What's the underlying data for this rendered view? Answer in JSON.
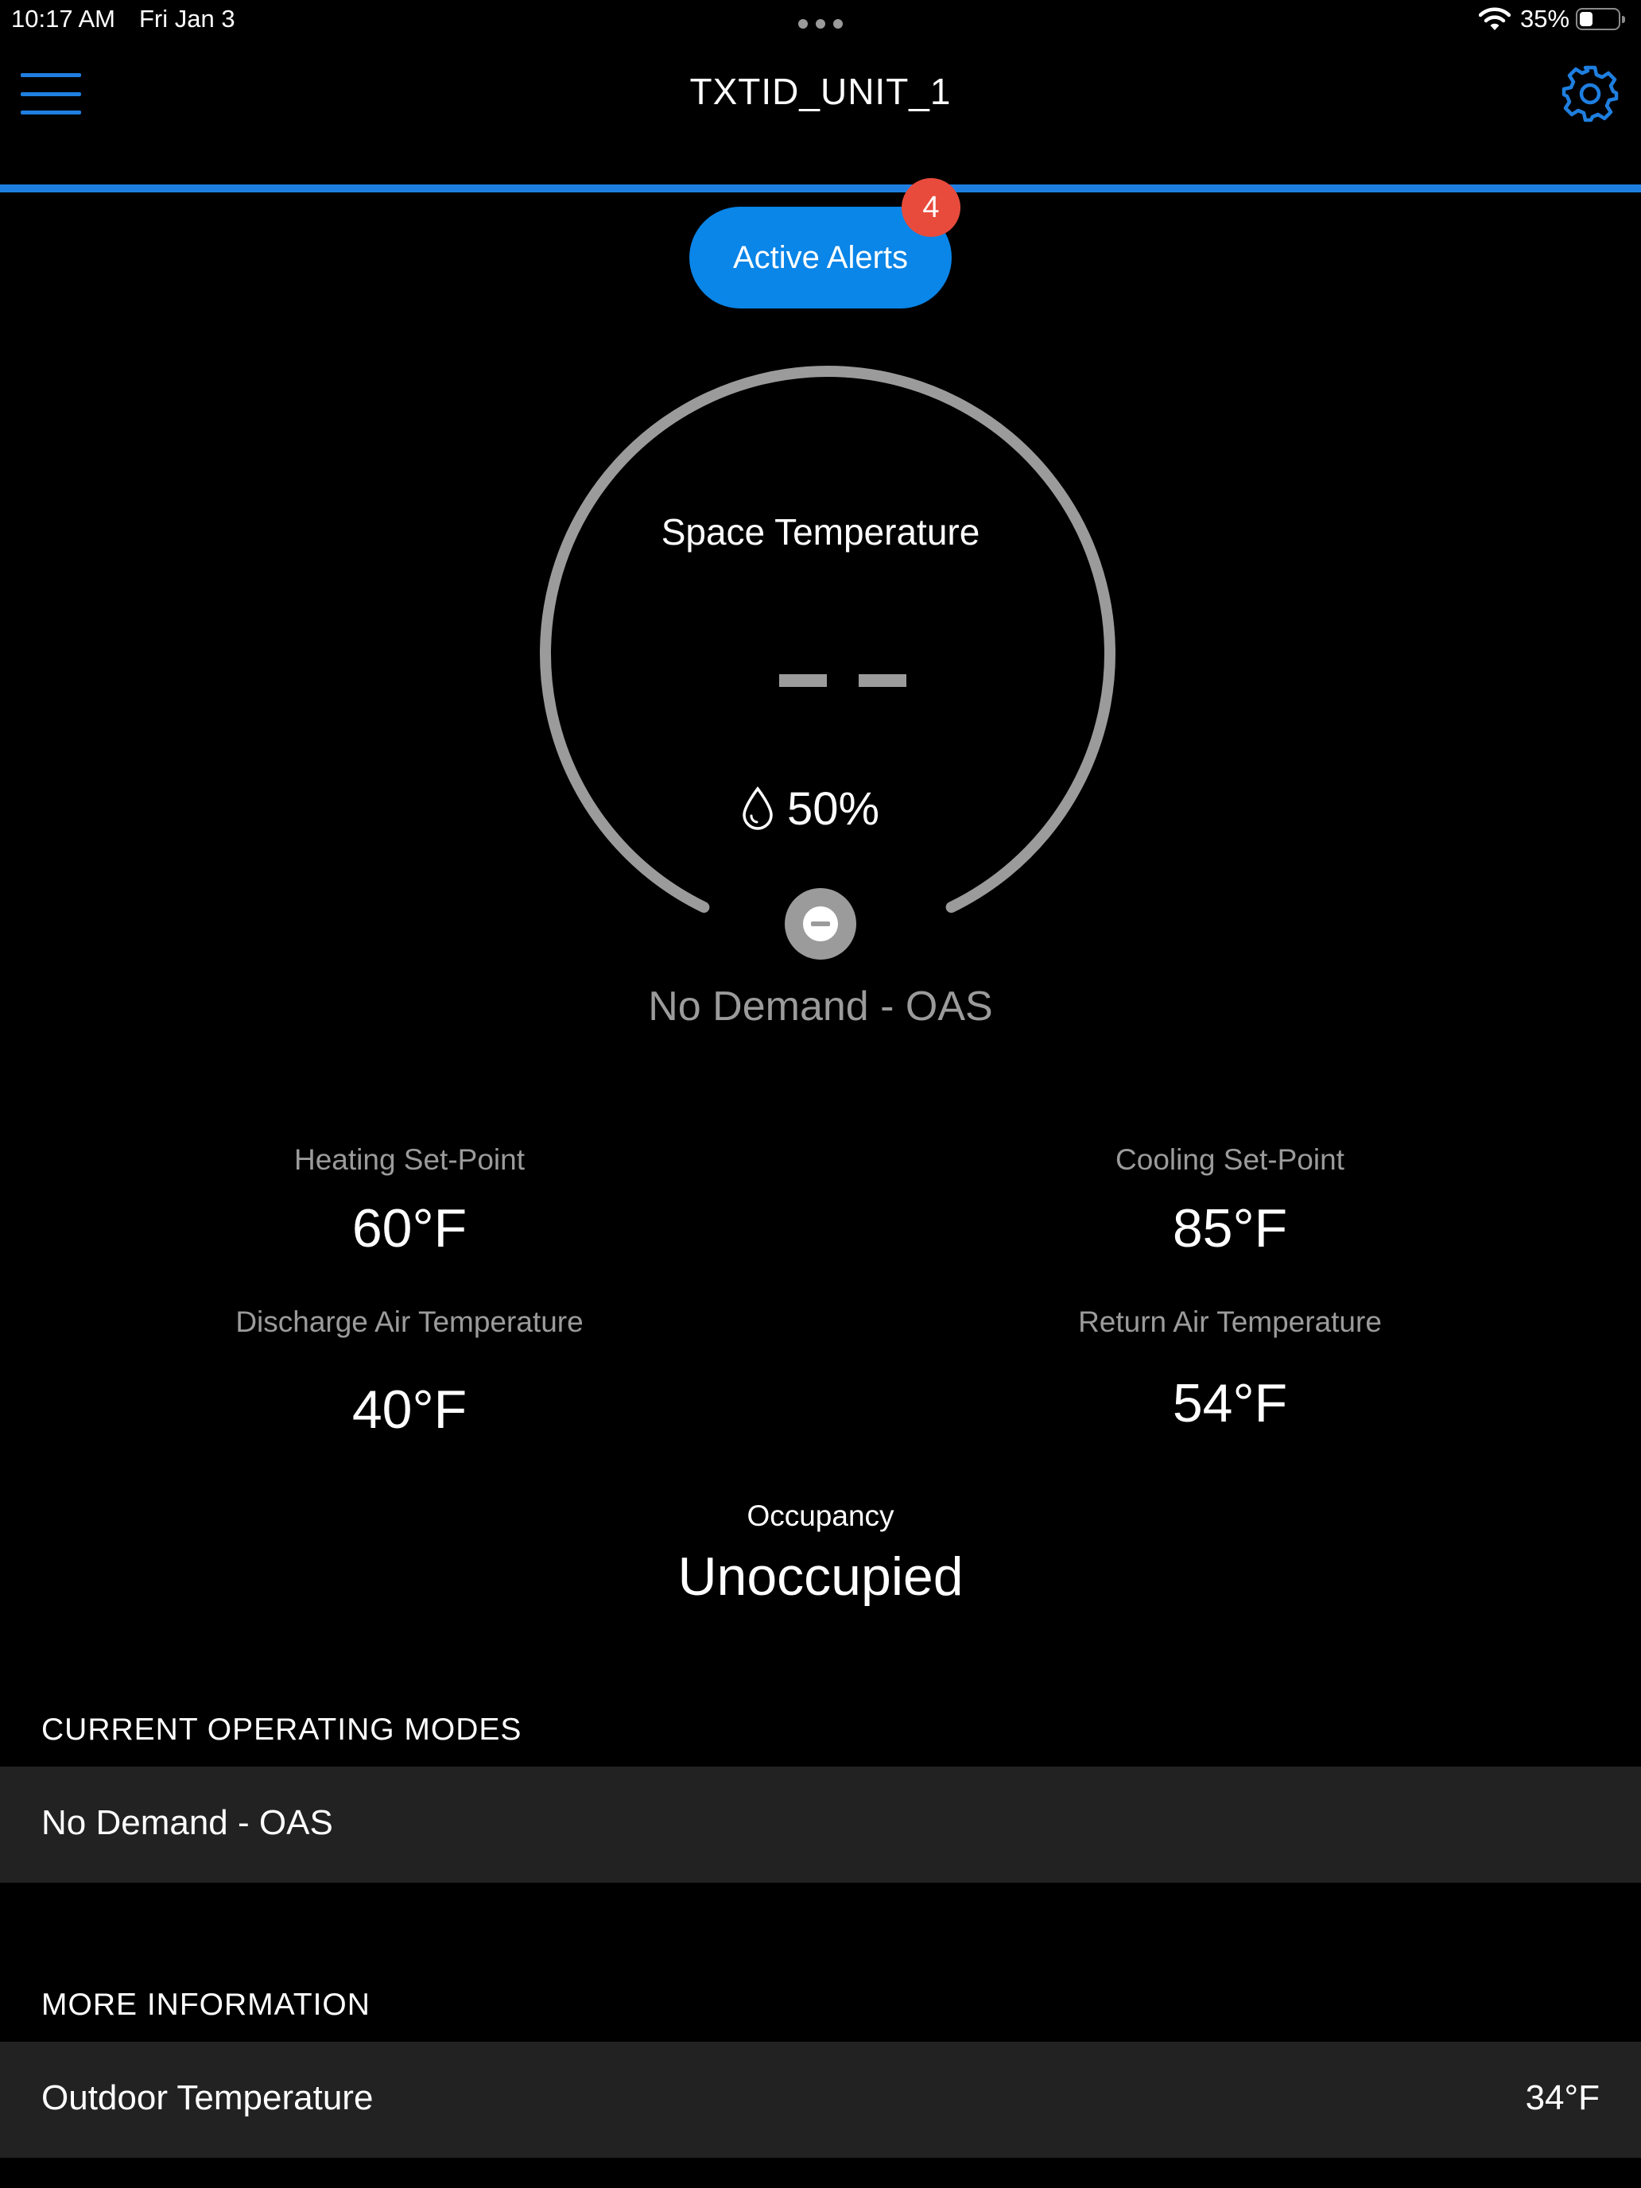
{
  "status_bar": {
    "time": "10:17 AM",
    "date": "Fri Jan 3",
    "battery_percent": "35%",
    "battery_level": 0.35
  },
  "nav": {
    "title": "TXTID_UNIT_1",
    "menu_icon": "hamburger-menu-icon",
    "settings_icon": "gear-icon"
  },
  "alerts": {
    "label": "Active Alerts",
    "count": "4"
  },
  "dial": {
    "label": "Space Temperature",
    "value": "--",
    "humidity": "50%",
    "humidity_icon": "water-drop-icon",
    "mode_icon": "minus-circle-icon",
    "status": "No Demand - OAS"
  },
  "readings": {
    "heating_setpoint": {
      "label": "Heating Set-Point",
      "value": "60°F"
    },
    "cooling_setpoint": {
      "label": "Cooling Set-Point",
      "value": "85°F"
    },
    "discharge_air": {
      "label": "Discharge Air Temperature",
      "value": "40°F"
    },
    "return_air": {
      "label": "Return Air Temperature",
      "value": "54°F"
    }
  },
  "occupancy": {
    "label": "Occupancy",
    "value": "Unoccupied"
  },
  "operating_modes": {
    "header": "CURRENT OPERATING MODES",
    "items": [
      "No Demand - OAS"
    ]
  },
  "more_info": {
    "header": "MORE INFORMATION",
    "items": [
      {
        "label": "Outdoor Temperature",
        "value": "34°F"
      }
    ]
  },
  "colors": {
    "accent_blue": "#1f7fe0",
    "alert_button": "#0a85e8",
    "badge_red": "#e84b3c",
    "dial_gray": "#9b9b9b",
    "row_background": "#222222"
  }
}
